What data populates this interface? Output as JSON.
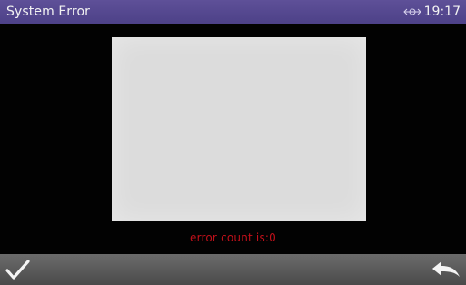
{
  "header": {
    "title": "System Error",
    "time": "19:17",
    "connection_icon": "usb-link-icon"
  },
  "main": {
    "error_message": "error count is:0"
  },
  "footer": {
    "confirm_icon": "checkmark-icon",
    "back_icon": "return-arrow-icon"
  },
  "colors": {
    "title_bar": "#53478d",
    "error_text": "#c2101a",
    "panel": "#dcdcdc",
    "footer": "#555555"
  }
}
